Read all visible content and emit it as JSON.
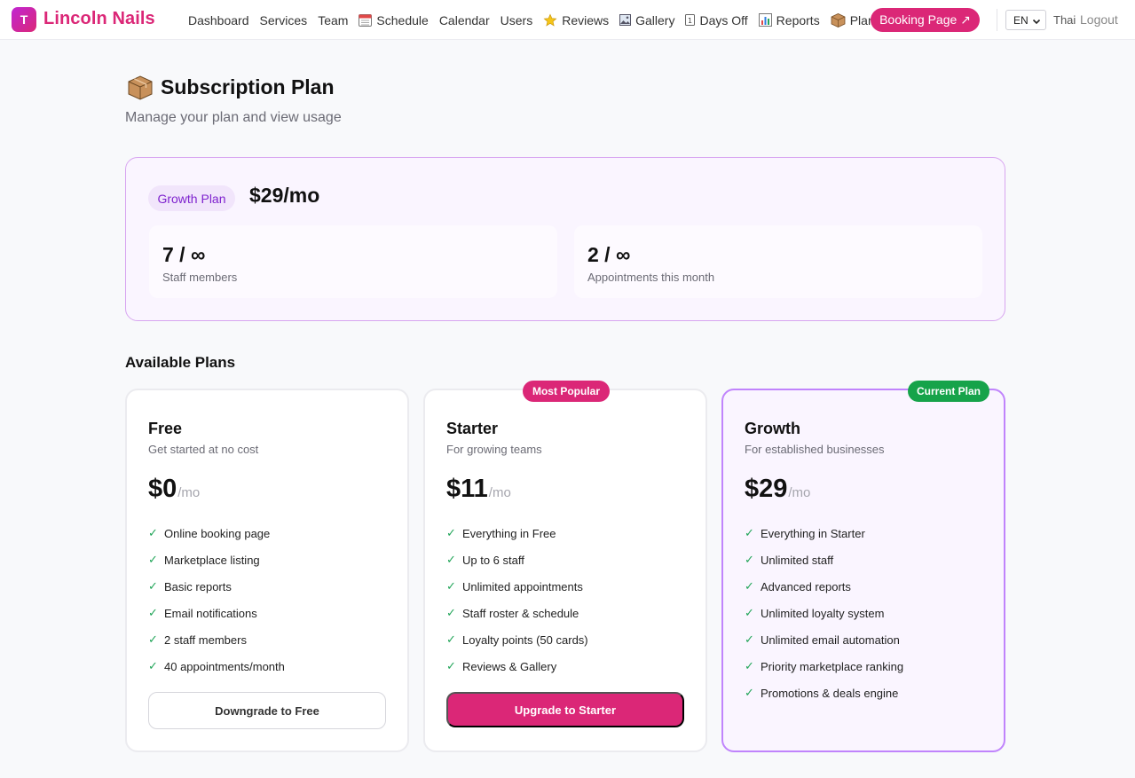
{
  "app": {
    "logo_letter": "T",
    "brand": "Lincoln Nails"
  },
  "nav": {
    "items": [
      {
        "label": "Dashboard",
        "icon": ""
      },
      {
        "label": "Services",
        "icon": ""
      },
      {
        "label": "Team",
        "icon": ""
      },
      {
        "label": "Schedule",
        "icon": "calendar-page-icon"
      },
      {
        "label": "Calendar",
        "icon": ""
      },
      {
        "label": "Users",
        "icon": ""
      },
      {
        "label": "Reviews",
        "icon": "star-icon"
      },
      {
        "label": "Gallery",
        "icon": "picture-icon"
      },
      {
        "label": "Days Off",
        "icon": "info-icon"
      },
      {
        "label": "Reports",
        "icon": "bar-chart-icon"
      },
      {
        "label": "Plan",
        "icon": "package-icon"
      }
    ],
    "booking_button": "Booking Page ↗",
    "language": "EN",
    "thai": "Thai",
    "logout": "Logout"
  },
  "page": {
    "title": "Subscription Plan",
    "subtitle": "Manage your plan and view usage",
    "icon": "package-icon"
  },
  "current_plan": {
    "name": "Growth Plan",
    "price": "$29/mo",
    "usage": [
      {
        "value": "7 / ∞",
        "label": "Staff members"
      },
      {
        "value": "2 / ∞",
        "label": "Appointments this month"
      }
    ]
  },
  "available": {
    "title": "Available Plans",
    "plans": [
      {
        "name": "Free",
        "desc": "Get started at no cost",
        "amount": "$0",
        "per": "/mo",
        "badge": "",
        "features": [
          "Online booking page",
          "Marketplace listing",
          "Basic reports",
          "Email notifications",
          "2 staff members",
          "40 appointments/month"
        ],
        "button": "Downgrade to Free"
      },
      {
        "name": "Starter",
        "desc": "For growing teams",
        "amount": "$11",
        "per": "/mo",
        "badge": "Most Popular",
        "features": [
          "Everything in Free",
          "Up to 6 staff",
          "Unlimited appointments",
          "Staff roster & schedule",
          "Loyalty points (50 cards)",
          "Reviews & Gallery"
        ],
        "button": "Upgrade to Starter"
      },
      {
        "name": "Growth",
        "desc": "For established businesses",
        "amount": "$29",
        "per": "/mo",
        "badge": "Current Plan",
        "features": [
          "Everything in Starter",
          "Unlimited staff",
          "Advanced reports",
          "Unlimited loyalty system",
          "Unlimited email automation",
          "Priority marketplace ranking",
          "Promotions & deals engine"
        ],
        "button": ""
      }
    ]
  },
  "colors": {
    "brand": "#db2777",
    "accent_purple": "#7e22ce",
    "current_badge": "#16a34a",
    "check": "#22a559"
  }
}
